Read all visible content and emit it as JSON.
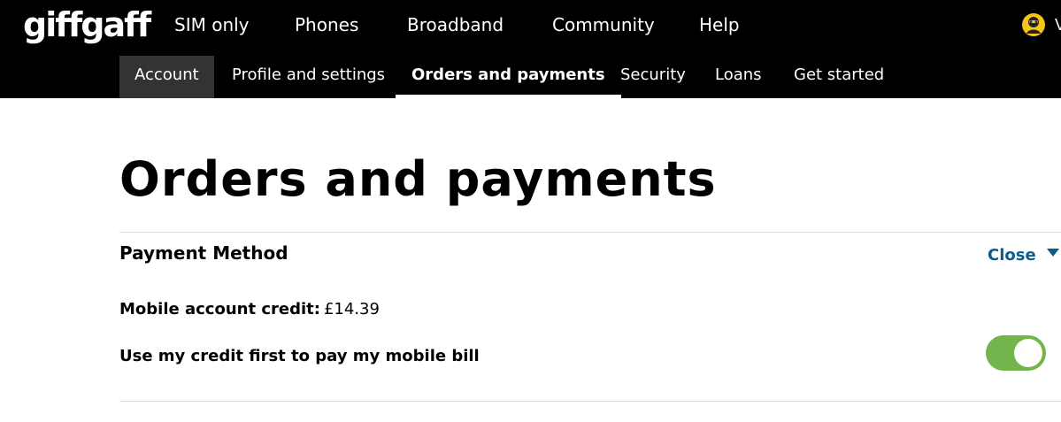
{
  "brand": {
    "logo_text": "giffgaff",
    "accent_color": "#72b54d",
    "link_color": "#0a5e8e"
  },
  "main_nav": {
    "items": [
      {
        "label": "SIM only"
      },
      {
        "label": "Phones"
      },
      {
        "label": "Broadband"
      },
      {
        "label": "Community"
      },
      {
        "label": "Help"
      }
    ],
    "user_avatar_icon": "user-avatar-icon",
    "user_initial": "V"
  },
  "sub_nav": {
    "items": [
      {
        "label": "Account"
      },
      {
        "label": "Profile and settings"
      },
      {
        "label": "Orders and payments"
      },
      {
        "label": "Security"
      },
      {
        "label": "Loans"
      },
      {
        "label": "Get started"
      }
    ],
    "active": "Orders and payments"
  },
  "page": {
    "title": "Orders and payments"
  },
  "payment_method": {
    "title": "Payment Method",
    "close_label": "Close",
    "credit_label": "Mobile account credit:",
    "credit_value": "£14.39",
    "toggle_label": "Use my credit first to pay my mobile bill",
    "toggle_on": true
  }
}
